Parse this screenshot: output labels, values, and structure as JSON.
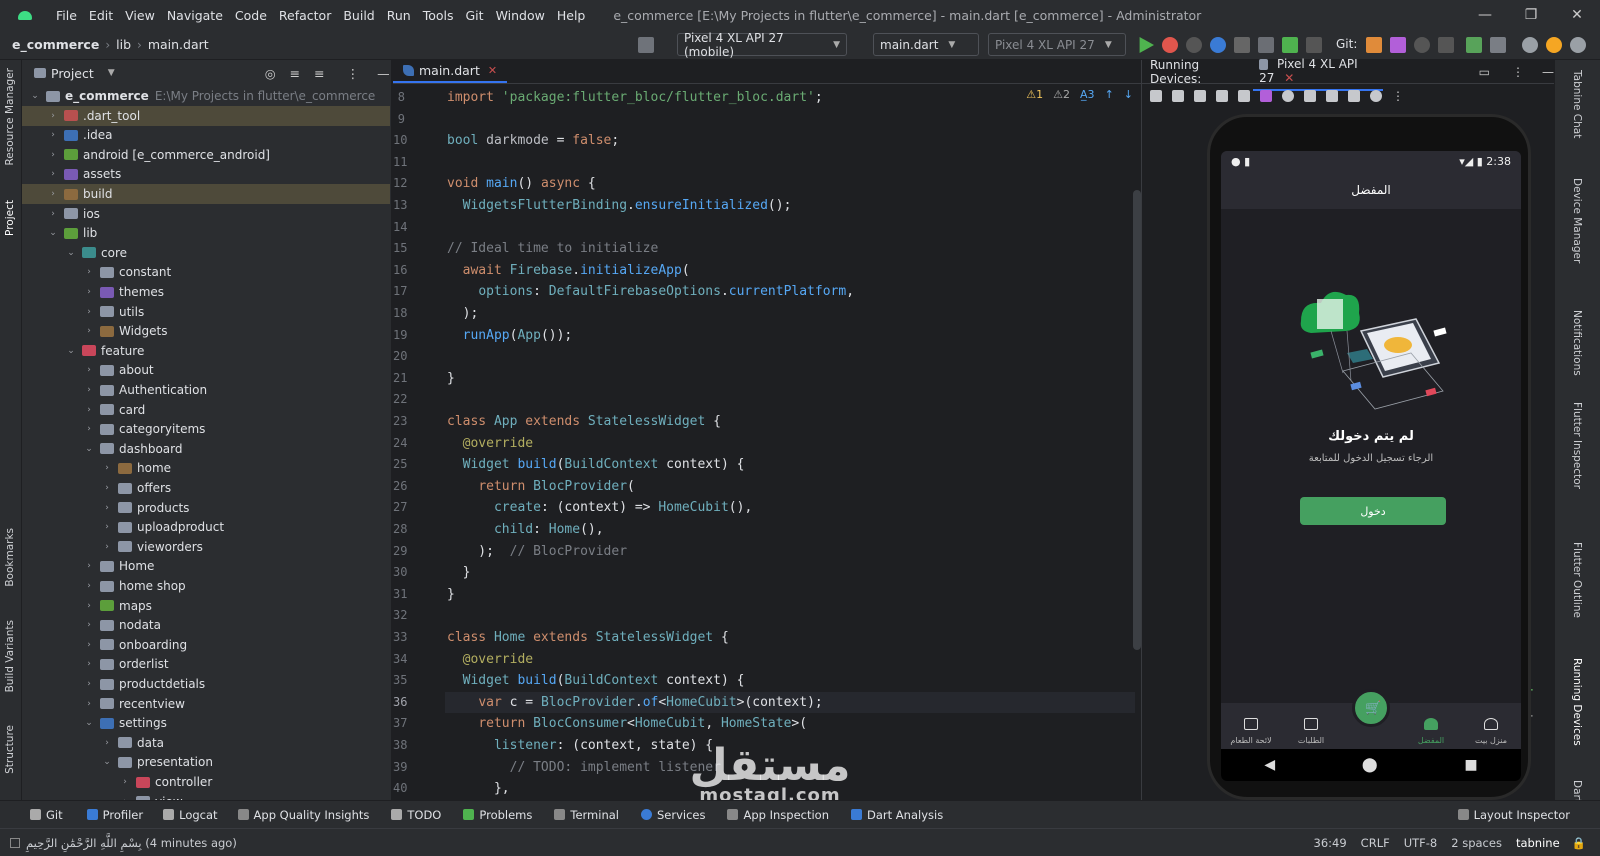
{
  "window": {
    "menu": [
      "File",
      "Edit",
      "View",
      "Navigate",
      "Code",
      "Refactor",
      "Build",
      "Run",
      "Tools",
      "Git",
      "Window",
      "Help"
    ],
    "title": "e_commerce [E:\\My Projects in flutter\\e_commerce] - main.dart [e_commerce] - Administrator"
  },
  "navbar": {
    "crumbs": [
      "e_commerce",
      "lib",
      "main.dart"
    ],
    "device_combo": "Pixel 4 XL API 27 (mobile)",
    "run_config": "main.dart",
    "device_combo2": "Pixel 4 XL API 27",
    "git_label": "Git:"
  },
  "leftstrip": {
    "labels": [
      "Resource Manager",
      "Project",
      "Bookmarks",
      "Build Variants",
      "Structure"
    ]
  },
  "project": {
    "header": "Project",
    "tree": [
      {
        "label": "e_commerce",
        "path": "E:\\My Projects in flutter\\e_commerce",
        "depth": 0,
        "open": true,
        "icon": "gray"
      },
      {
        "label": ".dart_tool",
        "depth": 1,
        "icon": "tool",
        "hl": "hlb"
      },
      {
        "label": ".idea",
        "depth": 1,
        "icon": "blue"
      },
      {
        "label": "android [e_commerce_android]",
        "depth": 1,
        "icon": "green"
      },
      {
        "label": "assets",
        "depth": 1,
        "icon": "purple"
      },
      {
        "label": "build",
        "depth": 1,
        "icon": "brown",
        "hl": "hlb"
      },
      {
        "label": "ios",
        "depth": 1,
        "icon": "gray"
      },
      {
        "label": "lib",
        "depth": 1,
        "icon": "green",
        "open": true
      },
      {
        "label": "core",
        "depth": 2,
        "icon": "teal",
        "open": true
      },
      {
        "label": "constant",
        "depth": 3,
        "icon": "gray"
      },
      {
        "label": "themes",
        "depth": 3,
        "icon": "purple"
      },
      {
        "label": "utils",
        "depth": 3,
        "icon": "gray"
      },
      {
        "label": "Widgets",
        "depth": 3,
        "icon": "brown"
      },
      {
        "label": "feature",
        "depth": 2,
        "icon": "red",
        "open": true
      },
      {
        "label": "about",
        "depth": 3,
        "icon": "gray"
      },
      {
        "label": "Authentication",
        "depth": 3,
        "icon": "gray"
      },
      {
        "label": "card",
        "depth": 3,
        "icon": "gray"
      },
      {
        "label": "categoryitems",
        "depth": 3,
        "icon": "gray"
      },
      {
        "label": "dashboard",
        "depth": 3,
        "icon": "gray",
        "open": true
      },
      {
        "label": "home",
        "depth": 4,
        "icon": "brown"
      },
      {
        "label": "offers",
        "depth": 4,
        "icon": "gray"
      },
      {
        "label": "products",
        "depth": 4,
        "icon": "gray"
      },
      {
        "label": "uploadproduct",
        "depth": 4,
        "icon": "gray"
      },
      {
        "label": "vieworders",
        "depth": 4,
        "icon": "gray"
      },
      {
        "label": "Home",
        "depth": 3,
        "icon": "gray"
      },
      {
        "label": "home shop",
        "depth": 3,
        "icon": "gray"
      },
      {
        "label": "maps",
        "depth": 3,
        "icon": "green"
      },
      {
        "label": "nodata",
        "depth": 3,
        "icon": "gray"
      },
      {
        "label": "onboarding",
        "depth": 3,
        "icon": "gray"
      },
      {
        "label": "orderlist",
        "depth": 3,
        "icon": "gray"
      },
      {
        "label": "productdetials",
        "depth": 3,
        "icon": "gray"
      },
      {
        "label": "recentview",
        "depth": 3,
        "icon": "gray"
      },
      {
        "label": "settings",
        "depth": 3,
        "icon": "blue",
        "open": true
      },
      {
        "label": "data",
        "depth": 4,
        "icon": "gray"
      },
      {
        "label": "presentation",
        "depth": 4,
        "icon": "gray",
        "open": true
      },
      {
        "label": "controller",
        "depth": 5,
        "icon": "red"
      },
      {
        "label": "view",
        "depth": 5,
        "icon": "gray"
      }
    ]
  },
  "editor": {
    "tab": "main.dart",
    "warnings": [
      "⚠1",
      "⚠2",
      "A̲3"
    ],
    "lines": [
      {
        "n": 8,
        "html": "<span class='kw'>import</span> <span class='str'>'package:flutter_bloc/flutter_bloc.dart'</span>;"
      },
      {
        "n": 9,
        "html": ""
      },
      {
        "n": 10,
        "html": "<span class='cls'>bool</span> <span class='id'>darkmode</span> = <span class='kw'>false</span>;"
      },
      {
        "n": 11,
        "html": ""
      },
      {
        "n": 12,
        "html": "<span class='kw'>void</span> <span class='fn'>main</span>() <span class='kw'>async</span> {"
      },
      {
        "n": 13,
        "html": "  <span class='cls'>WidgetsFlutterBinding</span>.<span class='fn'>ensureInitialized</span>();"
      },
      {
        "n": 14,
        "html": ""
      },
      {
        "n": 15,
        "html": "<span class='cm'>// Ideal time to initialize</span>"
      },
      {
        "n": 16,
        "html": "  <span class='kw'>await</span> <span class='cls'>Firebase</span>.<span class='fn'>initializeApp</span>("
      },
      {
        "n": 17,
        "html": "    <span class='prm'>options</span>: <span class='cls'>DefaultFirebaseOptions</span>.<span class='fn'>currentPlatform</span>,"
      },
      {
        "n": 18,
        "html": "  );"
      },
      {
        "n": 19,
        "html": "  <span class='fn'>runApp</span>(<span class='cls'>App</span>());"
      },
      {
        "n": 20,
        "html": ""
      },
      {
        "n": 21,
        "html": "}"
      },
      {
        "n": 22,
        "html": ""
      },
      {
        "n": 23,
        "html": "<span class='kw'>class</span> <span class='cls'>App</span> <span class='kw'>extends</span> <span class='cls'>StatelessWidget</span> {"
      },
      {
        "n": 24,
        "html": "  <span class='ann'>@override</span>"
      },
      {
        "n": 25,
        "html": "  <span class='cls'>Widget</span> <span class='fn'>build</span>(<span class='cls'>BuildContext</span> context) {"
      },
      {
        "n": 26,
        "html": "    <span class='kw'>return</span> <span class='cls'>BlocProvider</span>("
      },
      {
        "n": 27,
        "html": "      <span class='prm'>create</span>: (context) => <span class='cls'>HomeCubit</span>(),"
      },
      {
        "n": 28,
        "html": "      <span class='prm'>child</span>: <span class='cls'>Home</span>(),"
      },
      {
        "n": 29,
        "html": "    );  <span class='cm'>// BlocProvider</span>"
      },
      {
        "n": 30,
        "html": "  }"
      },
      {
        "n": 31,
        "html": "}"
      },
      {
        "n": 32,
        "html": ""
      },
      {
        "n": 33,
        "html": "<span class='kw'>class</span> <span class='cls'>Home</span> <span class='kw'>extends</span> <span class='cls'>StatelessWidget</span> {"
      },
      {
        "n": 34,
        "html": "  <span class='ann'>@override</span>"
      },
      {
        "n": 35,
        "html": "  <span class='cls'>Widget</span> <span class='fn'>build</span>(<span class='cls'>BuildContext</span> context) {"
      },
      {
        "n": 36,
        "html": "    <span class='kw'>var</span> c = <span class='cls'>BlocProvider</span>.<span class='fn'>of</span>&lt;<span class='cls'>HomeCubit</span>&gt;(context);",
        "cur": true
      },
      {
        "n": 37,
        "html": "    <span class='kw'>return</span> <span class='cls'>BlocConsumer</span>&lt;<span class='cls'>HomeCubit</span>, <span class='cls'>HomeState</span>&gt;("
      },
      {
        "n": 38,
        "html": "      <span class='prm'>listener</span>: (context, state) {"
      },
      {
        "n": 39,
        "html": "        <span class='cm'>// TODO: implement listener</span>"
      },
      {
        "n": 40,
        "html": "      },"
      }
    ]
  },
  "running_devices": {
    "title": "Running Devices:",
    "tab": "Pixel 4 XL API 27"
  },
  "phone": {
    "time": "2:38",
    "appbar_title": "المفضل",
    "msg_title": "لم يتم دخولك",
    "msg_sub": "الرجاء تسجيل الدخول للمتابعة",
    "login_label": "دخول",
    "nav": [
      "لائحة الطعام",
      "الطلبات",
      "",
      "المفضل",
      "منزل بيت"
    ]
  },
  "rightstrip": {
    "labels": [
      "Tabnine Chat",
      "Device Manager",
      "Notifications",
      "Flutter Inspector",
      "Flutter Outline",
      "Running Devices",
      "Dart"
    ]
  },
  "bottom_tools": [
    "Git",
    "Profiler",
    "Logcat",
    "App Quality Insights",
    "TODO",
    "Problems",
    "Terminal",
    "Services",
    "App Inspection",
    "Dart Analysis"
  ],
  "layout_inspector": "Layout Inspector",
  "status": {
    "message": "بِسْمِ اللَّهِ الرَّحْمَٰنِ الرَّحِيمِ (4 minutes ago)",
    "pos": "36:49",
    "eol": "CRLF",
    "enc": "UTF-8",
    "indent": "2 spaces",
    "plugin": "tabnine"
  },
  "watermark": {
    "ar": "مستقل",
    "en": "mostaql.com"
  }
}
